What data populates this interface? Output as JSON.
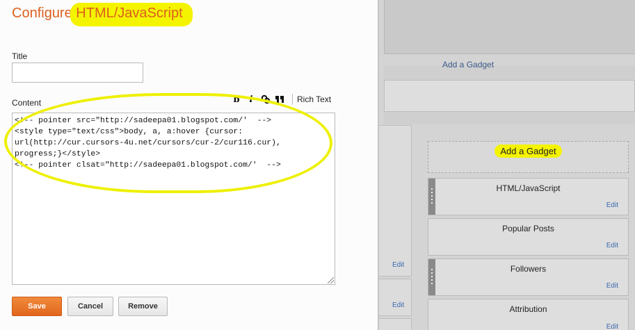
{
  "dialog": {
    "title_prefix": "Configure ",
    "title_highlight": "HTML/JavaScript",
    "title_label": "Title",
    "title_value": "",
    "content_label": "Content",
    "toolbar": {
      "bold": "b",
      "italic": "i",
      "link_icon": "link-icon",
      "quote": "66",
      "rich_text": "Rich Text"
    },
    "content_lines": [
      "<!-- pointer src=\"http://sadeepa01.blogspot.com/'  -->",
      "<style type=\"text/css\">body, a, a:hover {cursor:",
      "url(http://cur.cursors-4u.net/cursors/cur-2/cur116.cur),",
      "progress;}</style>",
      "<!-- pointer clsat=\"http://sadeepa01.blogspot.com/'  -->"
    ],
    "buttons": {
      "save": "Save",
      "cancel": "Cancel",
      "remove": "Remove"
    }
  },
  "layout_bg": {
    "header_label": "Add a Gadget",
    "add_gadget": "Add a Gadget",
    "left_edits": [
      "Edit",
      "Edit"
    ],
    "gadgets": [
      {
        "title": "HTML/JavaScript",
        "edit": "Edit",
        "handle": true
      },
      {
        "title": "Popular Posts",
        "edit": "Edit",
        "handle": false
      },
      {
        "title": "Followers",
        "edit": "Edit",
        "handle": true
      },
      {
        "title": "Attribution",
        "edit": "Edit",
        "handle": false
      }
    ]
  },
  "colors": {
    "accent": "#dd5f1e",
    "highlight": "#f4f300",
    "link": "#3a68b0"
  }
}
